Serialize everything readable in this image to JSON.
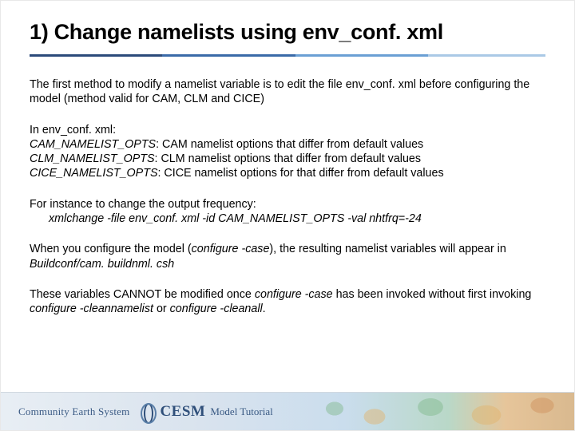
{
  "title": "1) Change namelists using env_conf. xml",
  "p_intro": "The first method to modify a namelist variable is to edit the file env_conf. xml before configuring the model (method valid for CAM, CLM and CICE)",
  "p_opts_lead": "In env_conf. xml:",
  "opts": {
    "cam": {
      "name": "CAM_NAMELIST_OPTS",
      "desc": ": CAM namelist options that differ from default values"
    },
    "clm": {
      "name": "CLM_NAMELIST_OPTS",
      "desc": ": CLM namelist options that differ from default values"
    },
    "cice": {
      "name": "CICE_NAMELIST_OPTS",
      "desc": ": CICE namelist options for that differ from default values"
    }
  },
  "p_example_lead": "For instance to change the output frequency:",
  "p_example_cmd": "xmlchange -file env_conf. xml -id CAM_NAMELIST_OPTS -val nhtfrq=-24",
  "p_configure": {
    "a": "When you configure the model (",
    "cmd": "configure -case",
    "b": "),  the resulting namelist variables will appear in ",
    "file": "Buildconf/cam. buildnml. csh"
  },
  "p_cannot": {
    "a": "These variables CANNOT be modified once ",
    "cmd1": "configure -case",
    "b": " has been invoked without first invoking ",
    "cmd2": "configure -cleannamelist",
    "c": " or ",
    "cmd3": "configure -cleanall",
    "d": "."
  },
  "footer": {
    "brand": "Community Earth System",
    "logo": "CESM",
    "tagline": "Model Tutorial"
  }
}
